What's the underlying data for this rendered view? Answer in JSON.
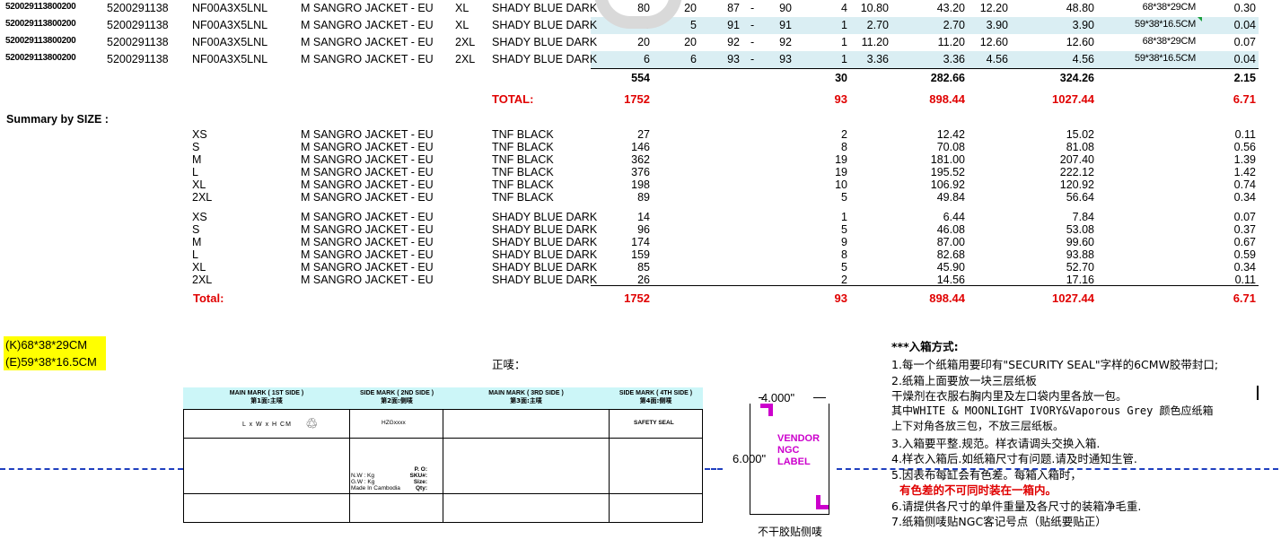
{
  "top_rows": [
    {
      "code": "520029113800200",
      "po": "5200291138",
      "style": "NF00A3X5LNL",
      "desc": "M SANGRO JACKET - EU",
      "size": "XL",
      "color": "SHADY BLUE DARK",
      "qty": "80",
      "pack": "20",
      "from": "87",
      "dash": "-",
      "to": "90",
      "ctns": "4",
      "nw": "10.80",
      "tnw": "43.20",
      "gw": "12.20",
      "tgw": "48.80",
      "dim": "68*38*29CM",
      "cbm": "0.30",
      "striped": false
    },
    {
      "code": "520029113800200",
      "po": "5200291138",
      "style": "NF00A3X5LNL",
      "desc": "M SANGRO JACKET - EU",
      "size": "XL",
      "color": "SHADY BLUE DARK",
      "qty": "5",
      "pack": "5",
      "from": "91",
      "dash": "-",
      "to": "91",
      "ctns": "1",
      "nw": "2.70",
      "tnw": "2.70",
      "gw": "3.90",
      "tgw": "3.90",
      "dim": "59*38*16.5CM",
      "cbm": "0.04",
      "striped": true
    },
    {
      "code": "520029113800200",
      "po": "5200291138",
      "style": "NF00A3X5LNL",
      "desc": "M SANGRO JACKET - EU",
      "size": "2XL",
      "color": "SHADY BLUE DARK",
      "qty": "20",
      "pack": "20",
      "from": "92",
      "dash": "-",
      "to": "92",
      "ctns": "1",
      "nw": "11.20",
      "tnw": "11.20",
      "gw": "12.60",
      "tgw": "12.60",
      "dim": "68*38*29CM",
      "cbm": "0.07",
      "striped": false
    },
    {
      "code": "520029113800200",
      "po": "5200291138",
      "style": "NF00A3X5LNL",
      "desc": "M SANGRO JACKET - EU",
      "size": "2XL",
      "color": "SHADY BLUE DARK",
      "qty": "6",
      "pack": "6",
      "from": "93",
      "dash": "-",
      "to": "93",
      "ctns": "1",
      "nw": "3.36",
      "tnw": "3.36",
      "gw": "4.56",
      "tgw": "4.56",
      "dim": "59*38*16.5CM",
      "cbm": "0.04",
      "striped": true
    }
  ],
  "subtotal": {
    "qty": "554",
    "ctns": "30",
    "tnw": "282.66",
    "tgw": "324.26",
    "cbm": "2.15"
  },
  "total": {
    "label": "TOTAL:",
    "qty": "1752",
    "ctns": "93",
    "tnw": "898.44",
    "tgw": "1027.44",
    "cbm": "6.71"
  },
  "summary_title": "Summary by SIZE :",
  "summary_black": [
    {
      "size": "XS",
      "desc": "M SANGRO JACKET - EU",
      "color": "TNF BLACK",
      "qty": "27",
      "ctns": "2",
      "tnw": "12.42",
      "tgw": "15.02",
      "cbm": "0.11"
    },
    {
      "size": "S",
      "desc": "M SANGRO JACKET - EU",
      "color": "TNF BLACK",
      "qty": "146",
      "ctns": "8",
      "tnw": "70.08",
      "tgw": "81.08",
      "cbm": "0.56"
    },
    {
      "size": "M",
      "desc": "M SANGRO JACKET - EU",
      "color": "TNF BLACK",
      "qty": "362",
      "ctns": "19",
      "tnw": "181.00",
      "tgw": "207.40",
      "cbm": "1.39"
    },
    {
      "size": "L",
      "desc": "M SANGRO JACKET - EU",
      "color": "TNF BLACK",
      "qty": "376",
      "ctns": "19",
      "tnw": "195.52",
      "tgw": "222.12",
      "cbm": "1.42"
    },
    {
      "size": "XL",
      "desc": "M SANGRO JACKET - EU",
      "color": "TNF BLACK",
      "qty": "198",
      "ctns": "10",
      "tnw": "106.92",
      "tgw": "120.92",
      "cbm": "0.74"
    },
    {
      "size": "2XL",
      "desc": "M SANGRO JACKET - EU",
      "color": "TNF BLACK",
      "qty": "89",
      "ctns": "5",
      "tnw": "49.84",
      "tgw": "56.64",
      "cbm": "0.34"
    }
  ],
  "summary_blue": [
    {
      "size": "XS",
      "desc": "M SANGRO JACKET - EU",
      "color": "SHADY BLUE DARK",
      "qty": "14",
      "ctns": "1",
      "tnw": "6.44",
      "tgw": "7.84",
      "cbm": "0.07"
    },
    {
      "size": "S",
      "desc": "M SANGRO JACKET - EU",
      "color": "SHADY BLUE DARK",
      "qty": "96",
      "ctns": "5",
      "tnw": "46.08",
      "tgw": "53.08",
      "cbm": "0.37"
    },
    {
      "size": "M",
      "desc": "M SANGRO JACKET - EU",
      "color": "SHADY BLUE DARK",
      "qty": "174",
      "ctns": "9",
      "tnw": "87.00",
      "tgw": "99.60",
      "cbm": "0.67"
    },
    {
      "size": "L",
      "desc": "M SANGRO JACKET - EU",
      "color": "SHADY BLUE DARK",
      "qty": "159",
      "ctns": "8",
      "tnw": "82.68",
      "tgw": "93.88",
      "cbm": "0.59"
    },
    {
      "size": "XL",
      "desc": "M SANGRO JACKET - EU",
      "color": "SHADY BLUE DARK",
      "qty": "85",
      "ctns": "5",
      "tnw": "45.90",
      "tgw": "52.70",
      "cbm": "0.34"
    },
    {
      "size": "2XL",
      "desc": "M SANGRO JACKET - EU",
      "color": "SHADY BLUE DARK",
      "qty": "26",
      "ctns": "2",
      "tnw": "14.56",
      "tgw": "17.16",
      "cbm": "0.11"
    }
  ],
  "summary_total": {
    "label": "Total:",
    "qty": "1752",
    "ctns": "93",
    "tnw": "898.44",
    "tgw": "1027.44",
    "cbm": "6.71"
  },
  "carton_sizes": [
    "(K)68*38*29CM",
    "(E)59*38*16.5CM"
  ],
  "front_mark_label": "正唛：",
  "shipping_marks": {
    "headers": [
      {
        "en": "MAIN MARK ( 1ST SIDE )",
        "cn": "第1面:主唛"
      },
      {
        "en": "SIDE MARK ( 2ND SIDE )",
        "cn": "第2面:侧唛"
      },
      {
        "en": "MAIN MARK ( 3RD SIDE )",
        "cn": "第3面:主唛"
      },
      {
        "en": "SIDE MARK ( 4TH SIDE )",
        "cn": "第4面:侧唛"
      }
    ],
    "dims_text": "L x W x H  CM",
    "hzg": "HZGxxxx",
    "safety": "SAFETY SEAL",
    "nw": "N.W :      Kg",
    "gw": "G.W :      Kg",
    "made_in": "Made In Cambodia",
    "po": "P. O:",
    "sku": "SKU#:",
    "size": "Size:",
    "qty": "Qty:"
  },
  "label_diagram": {
    "width": "4.000\"",
    "height": "6.000\"",
    "text": [
      "VENDOR",
      "NGC",
      "LABEL"
    ],
    "below": "不干胶贴侧唛"
  },
  "instructions": {
    "title": "***入箱方式:",
    "lines": [
      "1.每一个纸箱用要印有\"SECURITY SEAL\"字样的6CMW胶带封口;",
      "2.纸箱上面要放一块三层纸板",
      "干燥剂在衣服右胸内里及左口袋内里各放一包。",
      "其中WHITE & MOONLIGHT IVORY&Vaporous Grey 颜色应纸箱",
      "上下对角各放三包，不放三层纸板。",
      "3.入箱要平整.规范。样衣请调头交换入箱.",
      "4.样衣入箱后.如纸箱尺寸有问题.请及时通知生管.",
      "5.因表布每缸会有色差。每箱入箱时，"
    ],
    "red_line": "有色差的不可同时装在一箱内。",
    "lines_after": [
      "6.请提供各尺寸的单件重量及各尺寸的装箱净毛重.",
      "7.纸箱侧唛贴NGC客记号点（贴纸要贴正）"
    ]
  },
  "colors": {
    "stripe": "#daeef3",
    "red": "#e00000",
    "highlight": "#ffff00",
    "mark_header": "#ccf6f8",
    "dash": "#1f3fbf",
    "label_magenta": "#cc00cc"
  }
}
